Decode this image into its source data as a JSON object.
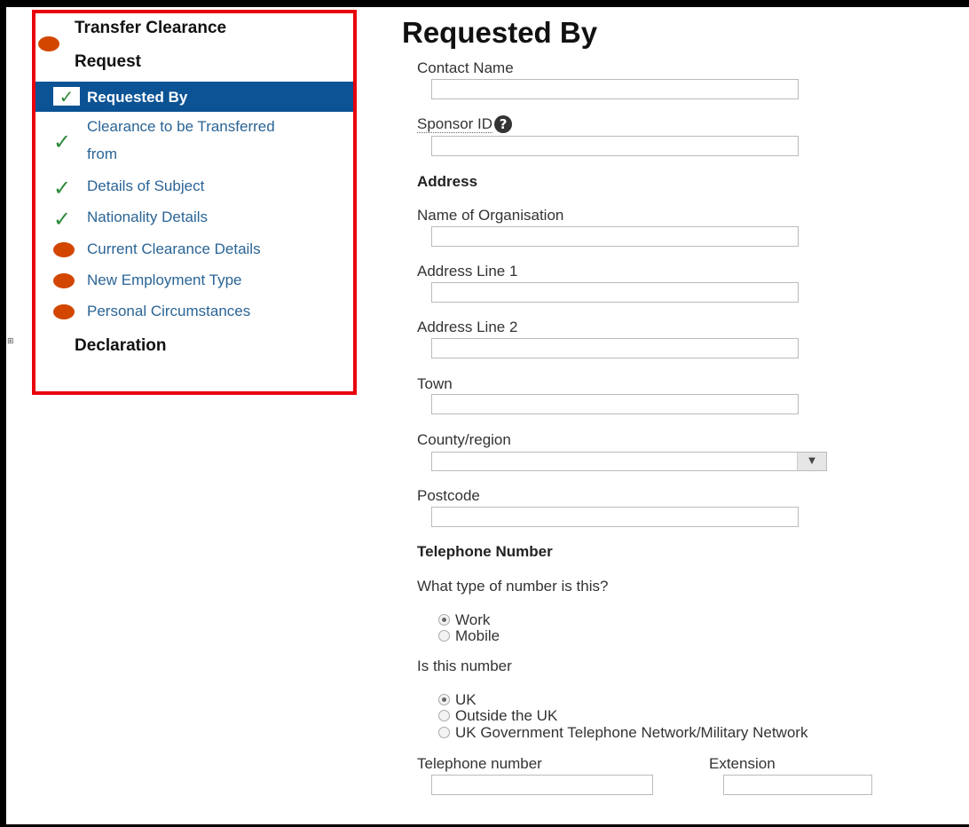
{
  "sidebar": {
    "section_title_line1": "Transfer Clearance",
    "section_title_line2": "Request",
    "items": [
      {
        "label": "Requested By",
        "state": "active-complete"
      },
      {
        "label_line1": "Clearance to be Transferred",
        "label_line2": "from",
        "state": "complete"
      },
      {
        "label": "Details of Subject",
        "state": "complete"
      },
      {
        "label": "Nationality Details",
        "state": "complete"
      },
      {
        "label": "Current Clearance Details",
        "state": "incomplete"
      },
      {
        "label": "New Employment Type",
        "state": "incomplete"
      },
      {
        "label": "Personal Circumstances",
        "state": "incomplete"
      }
    ],
    "declaration_title": "Declaration",
    "colors": {
      "highlight_border": "#e8000b",
      "active_bg": "#0b5394",
      "incomplete_dot": "#d24600",
      "check": "#2e8b3a",
      "link": "#2a6496"
    }
  },
  "icons": {
    "complete": "checkmark-icon",
    "incomplete": "orange-dot-icon",
    "help": "question-circle-icon",
    "expand": "expand-icon"
  },
  "form": {
    "title": "Requested By",
    "contact_name": {
      "label": "Contact Name",
      "value": ""
    },
    "sponsor_id": {
      "label": "Sponsor ID",
      "value": "",
      "help_glyph": "?"
    },
    "address_heading": "Address",
    "organisation": {
      "label": "Name of Organisation",
      "value": ""
    },
    "address_line1": {
      "label": "Address Line 1",
      "value": ""
    },
    "address_line2": {
      "label": "Address Line 2",
      "value": ""
    },
    "town": {
      "label": "Town",
      "value": ""
    },
    "county": {
      "label": "County/region",
      "value": ""
    },
    "postcode": {
      "label": "Postcode",
      "value": ""
    },
    "telephone_heading": "Telephone Number",
    "number_type": {
      "question": "What type of number is this?",
      "options": [
        "Work",
        "Mobile"
      ],
      "selected": "Work"
    },
    "number_location": {
      "question": "Is this number",
      "options": [
        "UK",
        "Outside the UK",
        "UK Government Telephone Network/Military Network"
      ],
      "selected": "UK"
    },
    "telephone_number": {
      "label": "Telephone number",
      "value": ""
    },
    "extension": {
      "label": "Extension",
      "value": ""
    }
  }
}
